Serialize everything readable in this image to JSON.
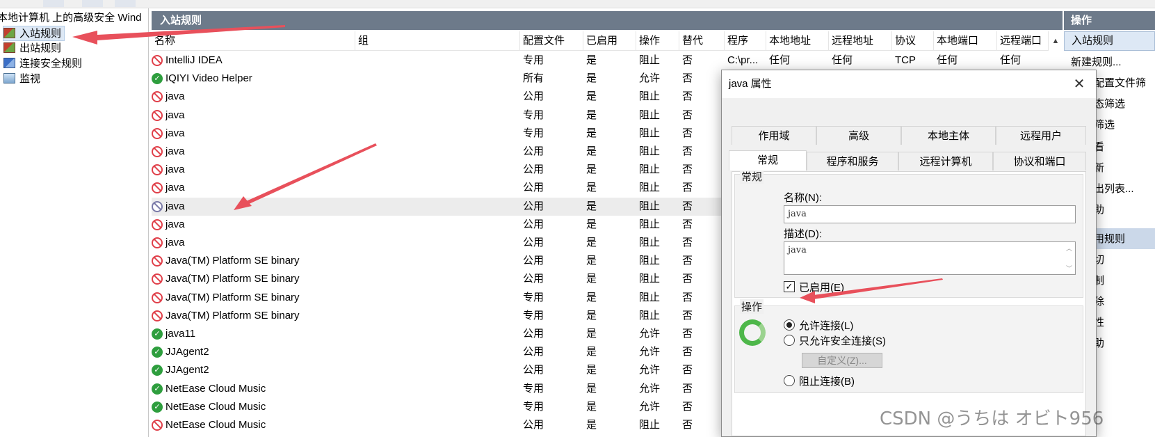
{
  "tree": {
    "root_label": "本地计算机 上的高级安全 Wind",
    "items": [
      {
        "label": "入站规则",
        "icon": "inbound-rules-icon",
        "selected": true
      },
      {
        "label": "出站规则",
        "icon": "outbound-rules-icon",
        "selected": false
      },
      {
        "label": "连接安全规则",
        "icon": "connection-security-icon",
        "selected": false
      },
      {
        "label": "监视",
        "icon": "monitor-icon",
        "selected": false
      }
    ]
  },
  "main": {
    "title": "入站规则",
    "columns": [
      "名称",
      "组",
      "配置文件",
      "已启用",
      "操作",
      "替代",
      "程序",
      "本地地址",
      "远程地址",
      "协议",
      "本地端口",
      "远程端口"
    ],
    "rows": [
      {
        "status": "block",
        "name": "IntelliJ IDEA",
        "profile": "专用",
        "enabled": "是",
        "action": "阻止",
        "override": "否",
        "program": "C:\\pr...",
        "local_addr": "任何",
        "remote_addr": "任何",
        "protocol": "TCP",
        "local_port": "任何",
        "remote_port": "任何"
      },
      {
        "status": "allow",
        "name": "IQIYI Video Helper",
        "profile": "所有",
        "enabled": "是",
        "action": "允许",
        "override": "否"
      },
      {
        "status": "block",
        "name": "java",
        "profile": "公用",
        "enabled": "是",
        "action": "阻止",
        "override": "否"
      },
      {
        "status": "block",
        "name": "java",
        "profile": "专用",
        "enabled": "是",
        "action": "阻止",
        "override": "否"
      },
      {
        "status": "block",
        "name": "java",
        "profile": "专用",
        "enabled": "是",
        "action": "阻止",
        "override": "否"
      },
      {
        "status": "block",
        "name": "java",
        "profile": "公用",
        "enabled": "是",
        "action": "阻止",
        "override": "否"
      },
      {
        "status": "block",
        "name": "java",
        "profile": "公用",
        "enabled": "是",
        "action": "阻止",
        "override": "否"
      },
      {
        "status": "block",
        "name": "java",
        "profile": "公用",
        "enabled": "是",
        "action": "阻止",
        "override": "否"
      },
      {
        "status": "gray",
        "name": "java",
        "profile": "公用",
        "enabled": "是",
        "action": "阻止",
        "override": "否",
        "highlight": true
      },
      {
        "status": "block",
        "name": "java",
        "profile": "公用",
        "enabled": "是",
        "action": "阻止",
        "override": "否"
      },
      {
        "status": "block",
        "name": "java",
        "profile": "公用",
        "enabled": "是",
        "action": "阻止",
        "override": "否"
      },
      {
        "status": "block",
        "name": "Java(TM) Platform SE binary",
        "profile": "公用",
        "enabled": "是",
        "action": "阻止",
        "override": "否"
      },
      {
        "status": "block",
        "name": "Java(TM) Platform SE binary",
        "profile": "公用",
        "enabled": "是",
        "action": "阻止",
        "override": "否"
      },
      {
        "status": "block",
        "name": "Java(TM) Platform SE binary",
        "profile": "专用",
        "enabled": "是",
        "action": "阻止",
        "override": "否"
      },
      {
        "status": "block",
        "name": "Java(TM) Platform SE binary",
        "profile": "专用",
        "enabled": "是",
        "action": "阻止",
        "override": "否"
      },
      {
        "status": "allow",
        "name": "java11",
        "profile": "公用",
        "enabled": "是",
        "action": "允许",
        "override": "否"
      },
      {
        "status": "allow",
        "name": "JJAgent2",
        "profile": "公用",
        "enabled": "是",
        "action": "允许",
        "override": "否"
      },
      {
        "status": "allow",
        "name": "JJAgent2",
        "profile": "公用",
        "enabled": "是",
        "action": "允许",
        "override": "否"
      },
      {
        "status": "allow",
        "name": "NetEase Cloud Music",
        "profile": "专用",
        "enabled": "是",
        "action": "允许",
        "override": "否"
      },
      {
        "status": "allow",
        "name": "NetEase Cloud Music",
        "profile": "专用",
        "enabled": "是",
        "action": "允许",
        "override": "否"
      },
      {
        "status": "block",
        "name": "NetEase Cloud Music",
        "profile": "公用",
        "enabled": "是",
        "action": "阻止",
        "override": "否"
      }
    ]
  },
  "actions": {
    "title": "操作",
    "section": "入站规则",
    "items": [
      "新建规则...",
      "按配置文件筛选",
      "按状态筛选",
      "按组筛选",
      "查看",
      "刷新",
      "导出列表...",
      "帮助",
      "禁用规则",
      "剪切",
      "复制",
      "删除",
      "属性",
      "帮助"
    ],
    "items_visible": [
      "新建规则...",
      "按配置文件筛",
      "状态筛选",
      "组筛选",
      "查看",
      "刷新",
      "导出列表...",
      "帮助",
      "禁用规则",
      "剪切",
      "复制",
      "删除",
      "属性",
      "帮助"
    ]
  },
  "dialog": {
    "title": "java 属性",
    "close": "✕",
    "tabs_row1": [
      "作用域",
      "高级",
      "本地主体",
      "远程用户"
    ],
    "tabs_row2": [
      "常规",
      "程序和服务",
      "远程计算机",
      "协议和端口"
    ],
    "active_tab": "常规",
    "general_group": "常规",
    "name_label": "名称(N):",
    "name_value": "java",
    "desc_label": "描述(D):",
    "desc_value": "java",
    "enabled_label": "已启用(E)",
    "enabled_checked": true,
    "action_group": "操作",
    "radio_allow": "允许连接(L)",
    "radio_secure": "只允许安全连接(S)",
    "customize_btn": "自定义(Z)...",
    "radio_block": "阻止连接(B)",
    "selected_radio": "allow"
  },
  "watermark": "CSDN @うちは オビト956",
  "colors": {
    "header": "#6d7a8a",
    "arrow": "#e8505b",
    "allow": "#2e9e3e",
    "block": "#e0404a"
  }
}
